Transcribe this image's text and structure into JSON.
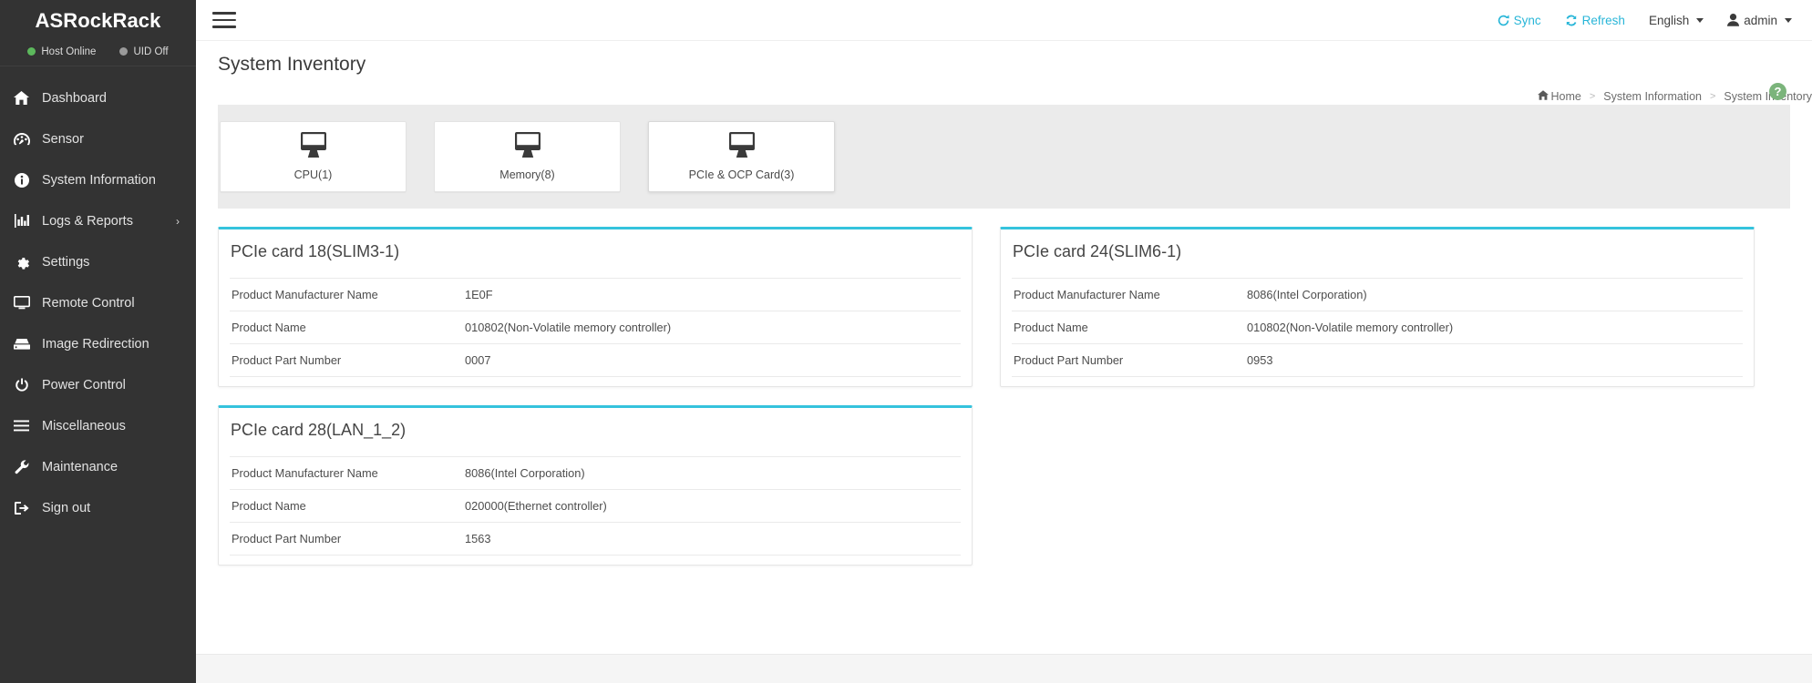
{
  "sidebar": {
    "brand": "ASRockRack",
    "status": [
      {
        "label": "Host Online",
        "color": "#5cb85c",
        "icon": "status-dot-green"
      },
      {
        "label": "UID Off",
        "color": "#9a9a9a",
        "icon": "status-dot-grey"
      }
    ],
    "items": [
      {
        "label": "Dashboard",
        "icon": "home-icon",
        "name": "dashboard",
        "caret": ""
      },
      {
        "label": "Sensor",
        "icon": "gauge-icon",
        "name": "sensor",
        "caret": ""
      },
      {
        "label": "System Information",
        "icon": "info-circle-icon",
        "name": "system-information",
        "caret": ""
      },
      {
        "label": "Logs & Reports",
        "icon": "bar-chart-icon",
        "name": "logs-and-reports",
        "caret": "›"
      },
      {
        "label": "Settings",
        "icon": "gear-icon",
        "name": "settings",
        "caret": ""
      },
      {
        "label": "Remote Control",
        "icon": "monitor-icon",
        "name": "remote-control",
        "caret": ""
      },
      {
        "label": "Image Redirection",
        "icon": "disk-icon",
        "name": "image-redirection",
        "caret": ""
      },
      {
        "label": "Power Control",
        "icon": "power-icon",
        "name": "power-control",
        "caret": ""
      },
      {
        "label": "Miscellaneous",
        "icon": "bars-icon",
        "name": "miscellaneous",
        "caret": ""
      },
      {
        "label": "Maintenance",
        "icon": "wrench-icon",
        "name": "maintenance",
        "caret": ""
      },
      {
        "label": "Sign out",
        "icon": "sign-out-icon",
        "name": "sign-out",
        "caret": ""
      }
    ]
  },
  "topbar": {
    "sync_label": "Sync",
    "refresh_label": "Refresh",
    "language_label": "English",
    "user_label": "admin"
  },
  "page": {
    "title": "System Inventory",
    "help_glyph": "?"
  },
  "breadcrumb": {
    "home": "Home",
    "level2": "System Information",
    "current": "System Inventory",
    "separator": ">"
  },
  "inventory_cards": [
    {
      "label": "CPU(1)",
      "name": "cpu",
      "selected": false
    },
    {
      "label": "Memory(8)",
      "name": "memory",
      "selected": false
    },
    {
      "label": "PCIe & OCP Card(3)",
      "name": "pcie-ocp-card",
      "selected": true
    }
  ],
  "panels": [
    {
      "title": "PCIe card 18(SLIM3-1)",
      "rows": [
        {
          "key": "Product Manufacturer Name",
          "value": "1E0F"
        },
        {
          "key": "Product Name",
          "value": "010802(Non-Volatile memory controller)"
        },
        {
          "key": "Product Part Number",
          "value": "0007"
        }
      ]
    },
    {
      "title": "PCIe card 24(SLIM6-1)",
      "rows": [
        {
          "key": "Product Manufacturer Name",
          "value": "8086(Intel Corporation)"
        },
        {
          "key": "Product Name",
          "value": "010802(Non-Volatile memory controller)"
        },
        {
          "key": "Product Part Number",
          "value": "0953"
        }
      ]
    },
    {
      "title": "PCIe card 28(LAN_1_2)",
      "rows": [
        {
          "key": "Product Manufacturer Name",
          "value": "8086(Intel Corporation)"
        },
        {
          "key": "Product Name",
          "value": "020000(Ethernet controller)"
        },
        {
          "key": "Product Part Number",
          "value": "1563"
        }
      ]
    }
  ],
  "colors": {
    "sidebar_bg": "#333333",
    "accent_cyan": "#35c3dd",
    "link_blue": "#29b6d8",
    "status_green": "#5cb85c",
    "help_green": "#7bb47b",
    "band_grey": "#ebebeb"
  }
}
